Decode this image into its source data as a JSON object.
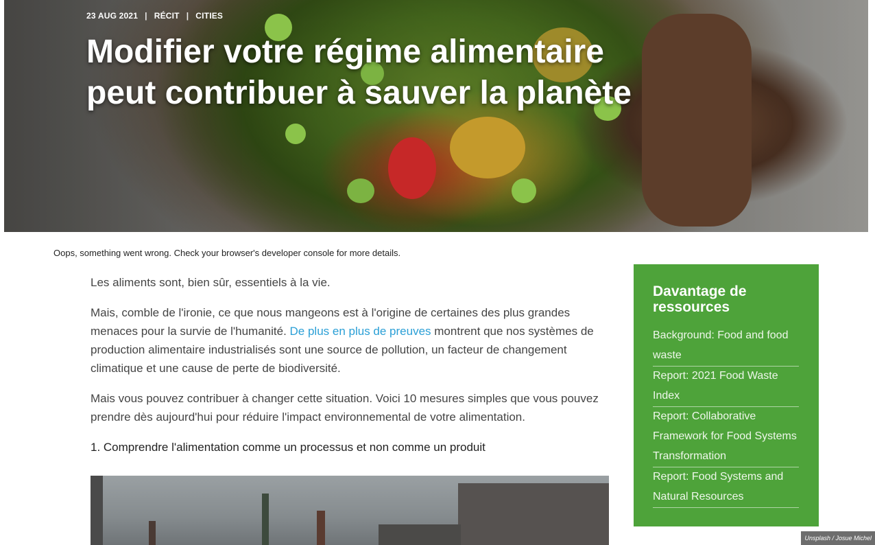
{
  "hero": {
    "date": "23 AUG 2021",
    "category": "RÉCIT",
    "tag": "CITIES",
    "separator": "|",
    "title": "Modifier votre régime alimentaire peut contribuer à sauver la planète",
    "credit": "Unsplash / Josue Michel"
  },
  "error_message": "Oops, something went wrong. Check your browser's developer console for more details.",
  "article": {
    "p1": "Les aliments sont, bien sûr, essentiels à la vie.",
    "p2_before": "Mais, comble de l'ironie, ce que nous mangeons est à l'origine de certaines des plus grandes menaces pour la survie de l'humanité. ",
    "p2_link": "De plus en plus de preuves",
    "p2_after": " montrent que nos systèmes de production alimentaire industrialisés sont une source de pollution, un facteur de changement climatique et une cause de perte de biodiversité.",
    "p3": "Mais vous pouvez contribuer à changer cette situation. Voici 10 mesures simples que vous pouvez prendre dès aujourd'hui pour réduire l'impact environnemental de votre alimentation.",
    "step1": "1. Comprendre l'alimentation comme un processus et non comme un produit"
  },
  "sidebar": {
    "title": "Davantage de ressources",
    "links": [
      "Background: Food and food waste",
      "Report: 2021 Food Waste Index",
      "Report: Collaborative Framework for Food Systems Transformation",
      "Report: Food Systems and Natural Resources"
    ]
  },
  "colors": {
    "sidebar_bg": "#4ea33a",
    "link": "#2a9fd6"
  }
}
